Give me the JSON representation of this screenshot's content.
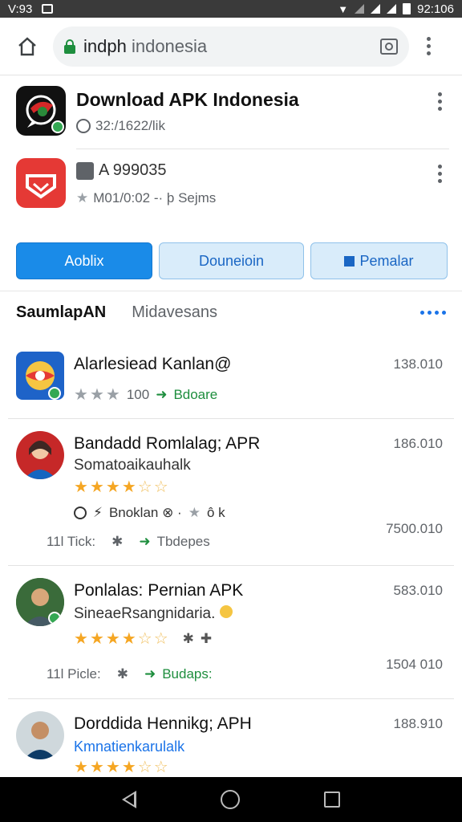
{
  "status_bar": {
    "time_left": "V:93",
    "time_right": "92:106"
  },
  "browser": {
    "url_main": "indph",
    "url_rest": " indonesia"
  },
  "cards": [
    {
      "title": "Download APK Indonesia",
      "meta": "32:/1622/lik"
    },
    {
      "title": "A 999035",
      "meta": "M01/0:02 -· þ Sejms"
    }
  ],
  "buttons": {
    "primary": "Aoblix",
    "secondary": "Douneioin",
    "tertiary": "Pemalar"
  },
  "tabs": {
    "active": "SaumlapAN",
    "inactive": "Midavesans"
  },
  "list": [
    {
      "name": "Alarlesiead Kanlan@",
      "size": "138.010",
      "rating_text": "100",
      "tag": "Bdoare"
    },
    {
      "name": "Bandadd Romlalag; APR",
      "size": "186.010",
      "subtitle": "Somatoaikauhalk",
      "extra": "Bnoklan ⊗ ·",
      "extra_right": "ô k",
      "size2": "7500.010",
      "row_label": "11l Tick:",
      "row_tag": "Tbdepes"
    },
    {
      "name": "Ponlalas: Pernian APK",
      "size": "583.010",
      "subtitle": "SineaeRsangnidaria.",
      "size2": "1504 010",
      "row_label": "11l Picle:",
      "row_tag": "Budaps:"
    },
    {
      "name": "Dorddida Hennikg; APH",
      "size": "188.910",
      "subtitle": "Kmnatienkarulalk"
    }
  ],
  "colors": {
    "accent": "#1a8be8",
    "green": "#1e8e3e",
    "star": "#f5a623"
  }
}
